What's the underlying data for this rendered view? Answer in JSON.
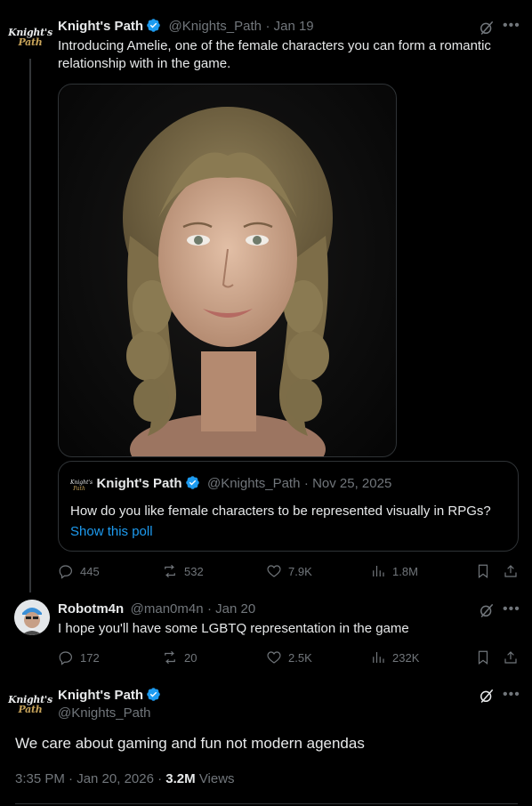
{
  "tweet1": {
    "name": "Knight's Path",
    "handle": "@Knights_Path",
    "date": "· Jan 19",
    "avatar_line1": "Knight's",
    "avatar_line2": "Path",
    "text": "Introducing Amelie, one of the female characters you can form a romantic relationship with in the game.",
    "image_icon": "portrait-image",
    "quote": {
      "name": "Knight's Path",
      "handle": "@Knights_Path",
      "date": "· Nov 25, 2025",
      "text": "How do you like female characters to be represented visually in RPGs?",
      "link": "Show this poll"
    },
    "actions": {
      "replies": "445",
      "reposts": "532",
      "likes": "7.9K",
      "views": "1.8M"
    }
  },
  "tweet2": {
    "name": "Robotm4n",
    "handle": "@man0m4n",
    "date": "· Jan 20",
    "text": "I hope you'll have some LGBTQ representation in the game",
    "actions": {
      "replies": "172",
      "reposts": "20",
      "likes": "2.5K",
      "views": "232K"
    }
  },
  "tweet3": {
    "name": "Knight's Path",
    "handle": "@Knights_Path",
    "avatar_line1": "Knight's",
    "avatar_line2": "Path",
    "text": "We care about gaming and fun not modern agendas",
    "timestamp": "3:35 PM · Jan 20, 2026 ·",
    "views_count": "3.2M",
    "views_label": "Views"
  },
  "colors": {
    "background": "#000000",
    "text": "#e7e9ea",
    "muted": "#71767b",
    "accent": "#1d9bf0",
    "border": "#2f3336"
  }
}
